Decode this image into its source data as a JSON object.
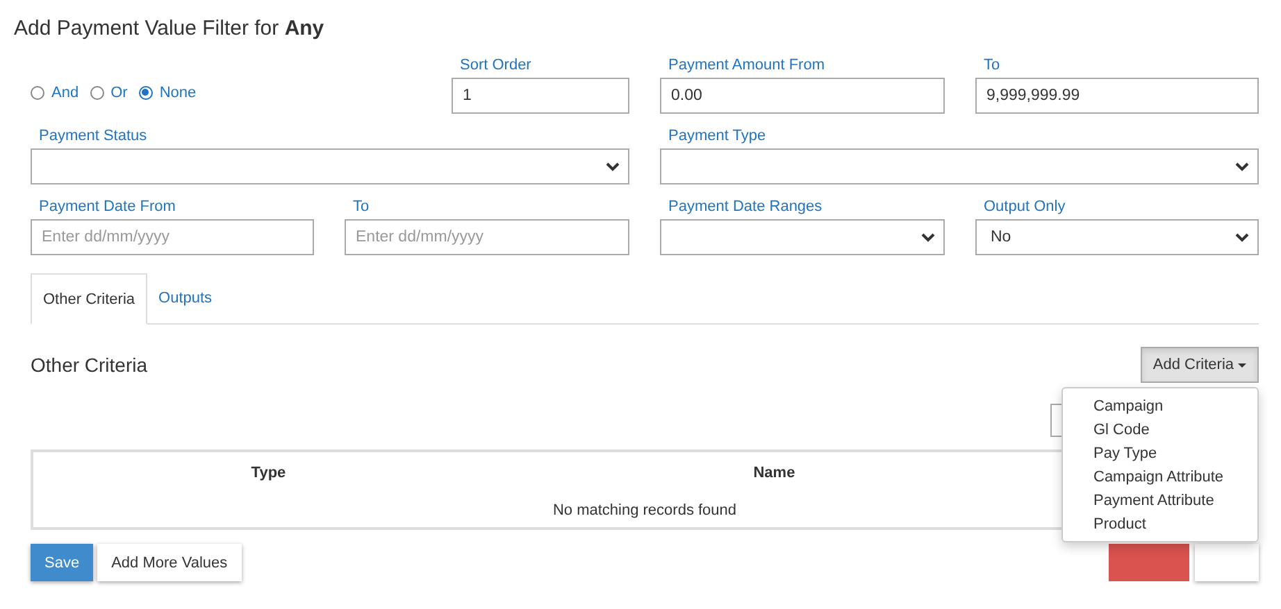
{
  "title": "Add Payment Value Filter for **Any**",
  "operators": [
    {
      "label": "And",
      "selected": false
    },
    {
      "label": "Or",
      "selected": false
    },
    {
      "label": "None",
      "selected": true
    }
  ],
  "sort_order": {
    "label": "Sort Order",
    "value": "1"
  },
  "payment_amount_from": {
    "label": "Payment Amount From",
    "value": "0.00"
  },
  "payment_amount_to": {
    "label": "To",
    "value": "9,999,999.99"
  },
  "payment_status": {
    "label": "Payment Status"
  },
  "payment_type": {
    "label": "Payment Type"
  },
  "payment_date_from": {
    "label": "Payment Date From",
    "placeholder": "Enter dd/mm/yyyy"
  },
  "payment_date_to": {
    "label": "To",
    "placeholder": "Enter dd/mm/yyyy"
  },
  "payment_date_ranges": {
    "label": "Payment Date Ranges"
  },
  "output_only": {
    "label": "Output Only",
    "value": "No"
  },
  "tabs": [
    {
      "label": "Other Criteria",
      "selected": true
    },
    {
      "label": "Outputs",
      "selected": false
    }
  ],
  "section_title": "Other Criteria",
  "add_criteria": {
    "label": "Add Criteria",
    "expanded": true,
    "menu": [
      "Campaign",
      "Gl Code",
      "Pay Type",
      "Campaign Attribute",
      "Payment Attribute",
      "Product"
    ]
  },
  "table": {
    "columns": [
      "Type",
      "Name"
    ],
    "empty_message": "No matching records found"
  },
  "buttons": [
    {
      "label": "Save",
      "kind": "primary"
    },
    {
      "label": "Add More Values",
      "kind": "default"
    }
  ]
}
